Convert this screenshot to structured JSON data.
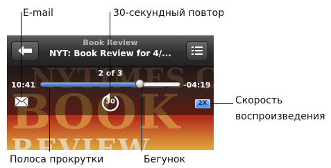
{
  "callouts": {
    "email": "E-mail",
    "repeat": "30-секундный повтор",
    "speed_line1": "Скорость",
    "speed_line2": "воспроизведения",
    "scrubber": "Полоса прокрутки",
    "playhead": "Бегунок"
  },
  "navbar": {
    "subtitle": "Book Review",
    "title": "NYT: Book Review for 4/..."
  },
  "playback": {
    "track_counter": "2 of 3",
    "elapsed": "10:41",
    "remaining": "-04:19",
    "progress_fraction": 0.71,
    "repeat_label": "30",
    "speed": "2X"
  },
  "artwork": {
    "line1": "NYTIMES.COM",
    "line2": "BOOK",
    "line3": "REVIEW"
  },
  "icons": [
    "back-arrow-icon",
    "list-icon",
    "mail-icon",
    "repeat-30-icon"
  ],
  "colors": {
    "progress_fill": "#2e6fe0",
    "speed_badge": "#3b84e6",
    "navbar": "#2f2f2f"
  }
}
